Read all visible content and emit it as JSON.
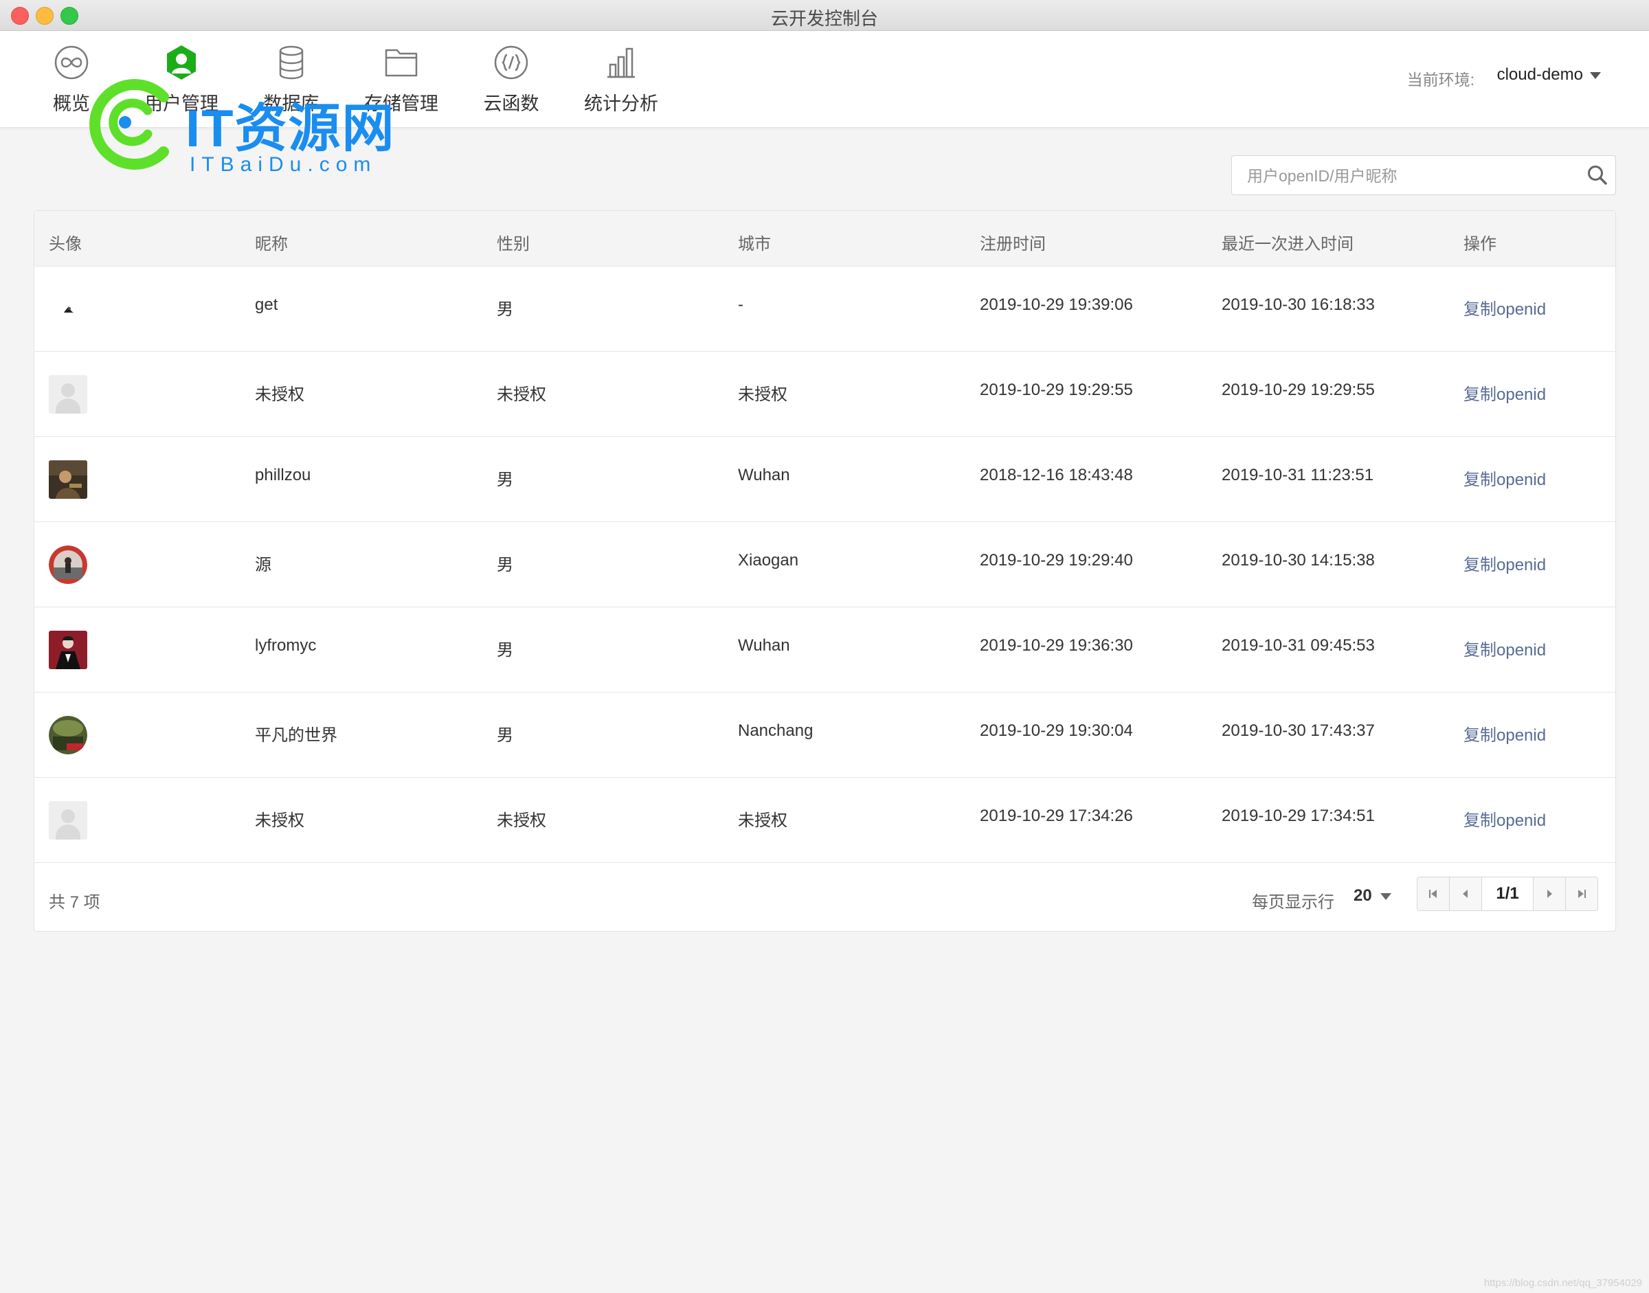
{
  "window": {
    "title": "云开发控制台"
  },
  "nav": [
    {
      "label": "概览",
      "icon": "overview-icon"
    },
    {
      "label": "用户管理",
      "icon": "user-icon",
      "active": true
    },
    {
      "label": "数据库",
      "icon": "database-icon"
    },
    {
      "label": "存储管理",
      "icon": "folder-icon"
    },
    {
      "label": "云函数",
      "icon": "cloud-function-icon"
    },
    {
      "label": "统计分析",
      "icon": "chart-icon"
    }
  ],
  "env": {
    "label": "当前环境:",
    "value": "cloud-demo"
  },
  "watermark": {
    "main": "IT资源网",
    "sub": "ITBaiDu.com"
  },
  "search": {
    "placeholder": "用户openID/用户昵称"
  },
  "table": {
    "headers": [
      "头像",
      "昵称",
      "性别",
      "城市",
      "注册时间",
      "最近一次进入时间",
      "操作"
    ],
    "rows": [
      {
        "nickname": "get",
        "gender": "男",
        "city": "-",
        "registered": "2019-10-29 19:39:06",
        "last_visit": "2019-10-30 16:18:33",
        "action": "复制openid"
      },
      {
        "nickname": "未授权",
        "gender": "未授权",
        "city": "未授权",
        "registered": "2019-10-29 19:29:55",
        "last_visit": "2019-10-29 19:29:55",
        "action": "复制openid"
      },
      {
        "nickname": "phillzou",
        "gender": "男",
        "city": "Wuhan",
        "registered": "2018-12-16 18:43:48",
        "last_visit": "2019-10-31 11:23:51",
        "action": "复制openid"
      },
      {
        "nickname": "源",
        "gender": "男",
        "city": "Xiaogan",
        "registered": "2019-10-29 19:29:40",
        "last_visit": "2019-10-30 14:15:38",
        "action": "复制openid"
      },
      {
        "nickname": "lyfromyc",
        "gender": "男",
        "city": "Wuhan",
        "registered": "2019-10-29 19:36:30",
        "last_visit": "2019-10-31 09:45:53",
        "action": "复制openid"
      },
      {
        "nickname": "平凡的世界",
        "gender": "男",
        "city": "Nanchang",
        "registered": "2019-10-29 19:30:04",
        "last_visit": "2019-10-30 17:43:37",
        "action": "复制openid"
      },
      {
        "nickname": "未授权",
        "gender": "未授权",
        "city": "未授权",
        "registered": "2019-10-29 17:34:26",
        "last_visit": "2019-10-29 17:34:51",
        "action": "复制openid"
      }
    ]
  },
  "footer": {
    "total": "共 7 项",
    "per_page_label": "每页显示行",
    "per_page_value": "20",
    "page": "1/1"
  },
  "credit": "https://blog.csdn.net/qq_37954029",
  "colors": {
    "accent": "#1aad19",
    "link": "#576b95",
    "watermark": "#1a8df0"
  }
}
